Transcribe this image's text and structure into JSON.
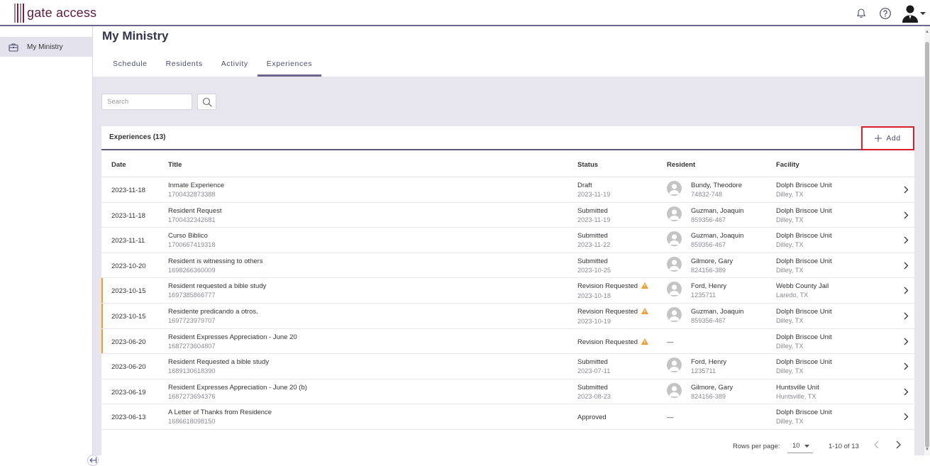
{
  "app": {
    "logo_text": "gate access"
  },
  "sidebar": {
    "items": [
      {
        "label": "My Ministry"
      }
    ]
  },
  "page": {
    "title": "My Ministry"
  },
  "tabs": [
    {
      "label": "Schedule"
    },
    {
      "label": "Residents"
    },
    {
      "label": "Activity"
    },
    {
      "label": "Experiences",
      "active": true
    }
  ],
  "search": {
    "placeholder": "Search"
  },
  "card": {
    "title": "Experiences (13)",
    "add_label": "Add"
  },
  "table": {
    "headers": {
      "date": "Date",
      "title": "Title",
      "status": "Status",
      "resident": "Resident",
      "facility": "Facility"
    },
    "rows": [
      {
        "date": "2023-11-18",
        "title": "Inmate Experience",
        "id": "1700432873388",
        "status": "Draft",
        "status_date": "2023-11-19",
        "resident_name": "Bundy, Theodore",
        "resident_id": "74832-748",
        "facility": "Dolph Briscoe Unit",
        "location": "Dilley, TX",
        "flag": false
      },
      {
        "date": "2023-11-18",
        "title": "Resident Request",
        "id": "1700432342681",
        "status": "Submitted",
        "status_date": "2023-11-19",
        "resident_name": "Guzman, Joaquin",
        "resident_id": "859356-467",
        "facility": "Dolph Briscoe Unit",
        "location": "Dilley, TX",
        "flag": false
      },
      {
        "date": "2023-11-11",
        "title": "Curso Biblico",
        "id": "1700667419318",
        "status": "Submitted",
        "status_date": "2023-11-22",
        "resident_name": "Guzman, Joaquin",
        "resident_id": "859356-467",
        "facility": "Dolph Briscoe Unit",
        "location": "Dilley, TX",
        "flag": false
      },
      {
        "date": "2023-10-20",
        "title": "Resident is witnessing to others",
        "id": "1698266360009",
        "status": "Submitted",
        "status_date": "2023-10-25",
        "resident_name": "Gilmore, Gary",
        "resident_id": "824156-389",
        "facility": "Dolph Briscoe Unit",
        "location": "Dilley, TX",
        "flag": false
      },
      {
        "date": "2023-10-15",
        "title": "Resident requested a bible study",
        "id": "1697385866777",
        "status": "Revision Requested",
        "status_date": "2023-10-18",
        "resident_name": "Ford, Henry",
        "resident_id": "1235711",
        "facility": "Webb County Jail",
        "location": "Laredo, TX",
        "flag": true
      },
      {
        "date": "2023-10-15",
        "title": "Residente predicando a otros.",
        "id": "1697723979707",
        "status": "Revision Requested",
        "status_date": "2023-10-19",
        "resident_name": "Guzman, Joaquin",
        "resident_id": "859356-467",
        "facility": "Dolph Briscoe Unit",
        "location": "Dilley, TX",
        "flag": true
      },
      {
        "date": "2023-06-20",
        "title": "Resident Expresses Appreciation - June 20",
        "id": "1687273604807",
        "status": "Revision Requested",
        "status_date": "",
        "resident_name": "",
        "resident_id": "",
        "resident_none": "—",
        "facility": "Dolph Briscoe Unit",
        "location": "Dilley, TX",
        "flag": true
      },
      {
        "date": "2023-06-20",
        "title": "Resident Requested a bible study",
        "id": "1689130618390",
        "status": "Submitted",
        "status_date": "2023-07-11",
        "resident_name": "Ford, Henry",
        "resident_id": "1235711",
        "facility": "Dolph Briscoe Unit",
        "location": "Dilley, TX",
        "flag": false
      },
      {
        "date": "2023-06-19",
        "title": "Resident Expresses Appreciation - June 20 (b)",
        "id": "1687273694376",
        "status": "Submitted",
        "status_date": "2023-08-23",
        "resident_name": "Gilmore, Gary",
        "resident_id": "824156-389",
        "facility": "Huntsville Unit",
        "location": "Huntsville, TX",
        "flag": false
      },
      {
        "date": "2023-06-13",
        "title": "A Letter of Thanks from Residence",
        "id": "1686618098150",
        "status": "Approved",
        "status_date": "",
        "resident_name": "",
        "resident_id": "",
        "resident_none": "—",
        "facility": "Dolph Briscoe Unit",
        "location": "Dilley, TX",
        "flag": false
      }
    ]
  },
  "pagination": {
    "rows_per_page_label": "Rows per page:",
    "rows_per_page": "10",
    "range": "1-10 of 13"
  },
  "colors": {
    "accent": "#6f6690",
    "warning": "#f39a2e",
    "highlight": "#d6202b"
  },
  "icons": {
    "bell": "bell-icon",
    "help": "help-icon",
    "avatar": "user-avatar-icon",
    "search": "search-icon",
    "add": "plus-icon",
    "chevron": "chevron-right-icon"
  }
}
